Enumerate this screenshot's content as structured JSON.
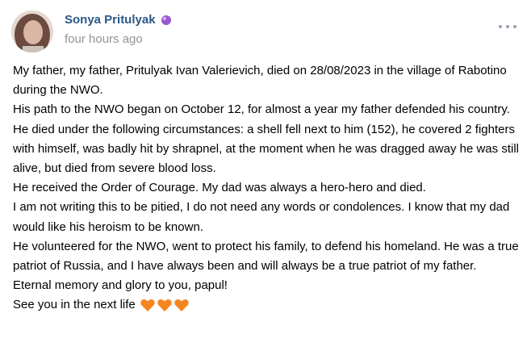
{
  "author": {
    "name": "Sonya Pritulyak",
    "badge_icon": "purple-orb-icon",
    "time": "four hours ago"
  },
  "menu": {
    "icon": "more-dots-icon"
  },
  "post": {
    "paragraphs": [
      "My father, my father, Pritulyak Ivan Valerievich, died on 28/08/2023 in the village of Rabotino during the NWO.",
      "His path to the NWO began on October 12, for almost a year my father defended his country.",
      "He died under the following circumstances: a shell fell next to him (152), he covered 2 fighters with himself, was badly hit by shrapnel, at the moment when he was dragged away he was still alive, but died from severe blood loss.",
      "He received the Order of Courage. My dad was always a hero-hero and died.",
      "I am not writing this to be pitied, I do not need any words or condolences. I know that my dad would like his heroism to be known.",
      "He volunteered for the NWO, went to protect his family, to defend his homeland. He was a true patriot of Russia, and I have always been and will always be a true patriot of my father.",
      "Eternal memory and glory to you, papul!",
      "See you in the next life"
    ],
    "trailing_emoji": [
      "orange-heart-icon",
      "orange-heart-icon",
      "orange-heart-icon"
    ]
  },
  "colors": {
    "author_link": "#2a5885",
    "time_gray": "#939393",
    "menu_dots": "#99a2ad",
    "heart": "#f5851f"
  }
}
